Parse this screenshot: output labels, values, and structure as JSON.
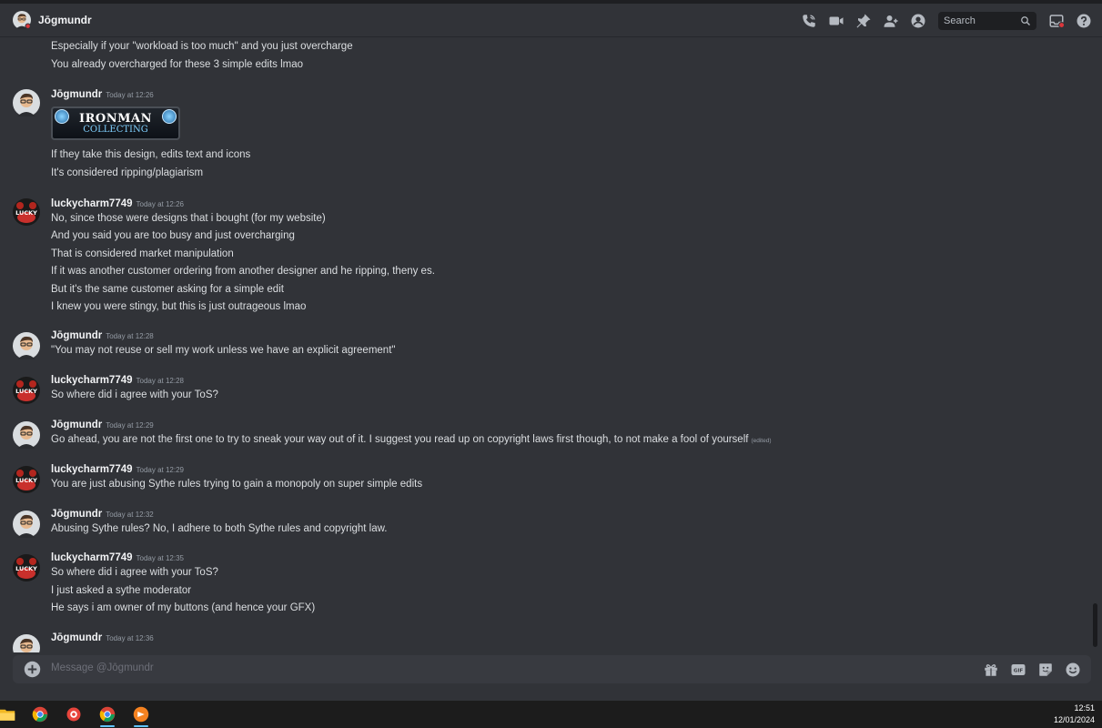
{
  "header": {
    "title": "Jōgmundr",
    "search_placeholder": "Search"
  },
  "messages": [
    {
      "continuation": true,
      "lines": [
        "Especially if your \"workload is too much\" and you just overcharge",
        "You already overcharged for these 3 simple edits lmao"
      ]
    },
    {
      "author": "Jōgmundr",
      "time": "Today at 12:26",
      "attachment": {
        "line1": "IRONMAN",
        "line2": "COLLECTING"
      },
      "lines": [
        "If they take this design, edits text and icons",
        "It's considered ripping/plagiarism"
      ]
    },
    {
      "author": "luckycharm7749",
      "time": "Today at 12:26",
      "lines": [
        "No, since those were designs that i bought (for my website)",
        "And you said you are too busy and just overcharging",
        "That is considered market manipulation",
        "If it was another customer ordering from another designer and he ripping, theny es.",
        "But it's the same customer asking for a simple edit",
        "I knew you were stingy, but this is just outrageous lmao"
      ]
    },
    {
      "author": "Jōgmundr",
      "time": "Today at 12:28",
      "lines": [
        "\"You may not reuse or sell my work unless we have an explicit agreement\""
      ]
    },
    {
      "author": "luckycharm7749",
      "time": "Today at 12:28",
      "lines": [
        "So where did i agree with your ToS?"
      ]
    },
    {
      "author": "Jōgmundr",
      "time": "Today at 12:29",
      "lines": [
        "Go ahead, you are not the first one to try to sneak your way out of it. I suggest you read up on copyright laws first though, to not make a fool of yourself"
      ],
      "edited": "(edited)"
    },
    {
      "author": "luckycharm7749",
      "time": "Today at 12:29",
      "lines": [
        "You are just abusing Sythe rules trying to gain a monopoly on super simple edits"
      ]
    },
    {
      "author": "Jōgmundr",
      "time": "Today at 12:32",
      "lines": [
        "Abusing Sythe rules? No, I adhere to both Sythe rules and copyright law."
      ]
    },
    {
      "author": "luckycharm7749",
      "time": "Today at 12:35",
      "lines": [
        "So where did i agree with your ToS?",
        "I just asked a sythe moderator",
        "He says i am owner of my buttons (and hence your GFX)"
      ]
    },
    {
      "author": "Jōgmundr",
      "time": "Today at 12:36",
      "lines": []
    }
  ],
  "composer": {
    "placeholder": "Message @Jōgmundr"
  },
  "avatar_text": "LUCKY",
  "taskbar": {
    "time": "12:51",
    "date": "12/01/2024"
  },
  "colors": {
    "background": "#313338",
    "accent_red": "#da373c",
    "taskbar_underline": "#61c4ff"
  }
}
